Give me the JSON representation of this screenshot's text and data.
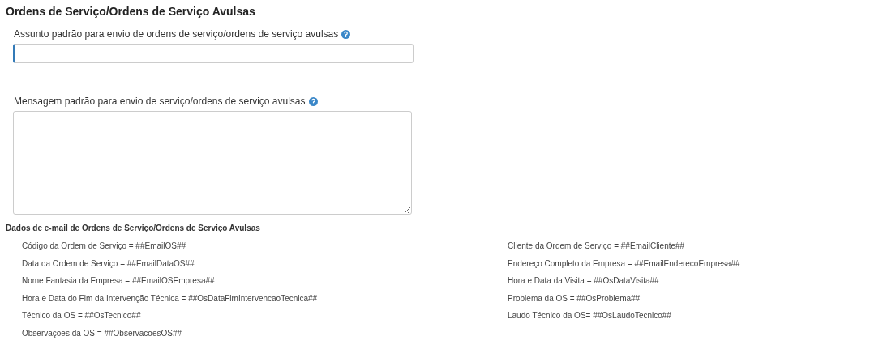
{
  "title": "Ordens de Serviço/Ordens de Serviço Avulsas",
  "subject": {
    "label": "Assunto padrão para envio de ordens de serviço/ordens de serviço avulsas",
    "focused": true
  },
  "message": {
    "label": "Mensagem padrão para envio de serviço/ordens de serviço avulsas"
  },
  "email_data": {
    "title": "Dados de e-mail de Ordens de Serviço/Ordens de Serviço Avulsas",
    "left": [
      "Código da Ordem de Serviço = ##EmailOS##",
      "Data da Ordem de Serviço = ##EmailDataOS##",
      "Nome Fantasia da Empresa = ##EmailOSEmpresa##",
      "Hora e Data do Fim da Intervenção Técnica = ##OsDataFimIntervencaoTecnica##",
      "Técnico da OS = ##OsTecnico##",
      "Observações da OS = ##ObservacoesOS##"
    ],
    "right": [
      "Cliente da Ordem de Serviço = ##EmailCliente##",
      "Endereço Completo da Empresa = ##EmailEnderecoEmpresa##",
      "Hora e Data da Visita = ##OsDataVisita##",
      "Problema da OS = ##OsProblema##",
      "Laudo Técnico da OS= ##OsLaudoTecnico##"
    ]
  }
}
